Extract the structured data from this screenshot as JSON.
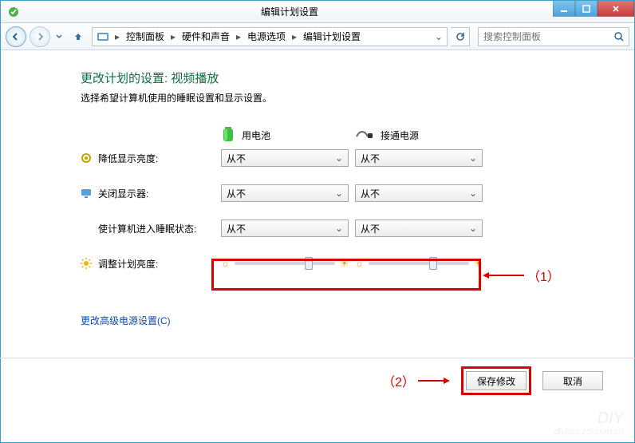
{
  "window": {
    "title": "编辑计划设置"
  },
  "breadcrumb": {
    "items": [
      "控制面板",
      "硬件和声音",
      "电源选项",
      "编辑计划设置"
    ]
  },
  "search": {
    "placeholder": "搜索控制面板"
  },
  "page": {
    "heading": "更改计划的设置: 视频播放",
    "subtext": "选择希望计算机使用的睡眠设置和显示设置。"
  },
  "columns": {
    "battery": "用电池",
    "ac": "接通电源"
  },
  "rows": {
    "dim": {
      "label": "降低显示亮度:",
      "battery": "从不",
      "ac": "从不"
    },
    "off": {
      "label": "关闭显示器:",
      "battery": "从不",
      "ac": "从不"
    },
    "sleep": {
      "label": "使计算机进入睡眠状态:",
      "battery": "从不",
      "ac": "从不"
    },
    "bright": {
      "label": "调整计划亮度:"
    }
  },
  "link": "更改高级电源设置(C)",
  "buttons": {
    "save": "保存修改",
    "cancel": "取消"
  },
  "annotations": {
    "one": "（1）",
    "two": "（2）"
  },
  "watermark": {
    "top": "DIY",
    "bottom": "diybbs.zol.com.cn"
  }
}
